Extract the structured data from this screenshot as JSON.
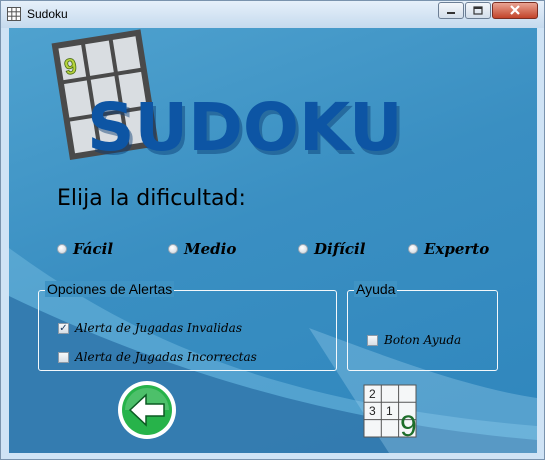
{
  "window": {
    "title": "Sudoku",
    "controls": {
      "minimize": "minimize-icon",
      "maximize": "maximize-icon",
      "close": "close-icon"
    }
  },
  "logo": {
    "text": "SUDOKU",
    "grid_digit": "9",
    "color": "#0d55a4"
  },
  "difficulty": {
    "heading": "Elija la dificultad:",
    "options": [
      "Fácil",
      "Medio",
      "Difícil",
      "Experto"
    ],
    "selected": null
  },
  "alerts": {
    "title": "Opciones de Alertas",
    "items": [
      {
        "label": "Alerta de Jugadas Invalidas",
        "checked": true,
        "mark": "✓"
      },
      {
        "label": "Alerta de Jugadas Incorrectas",
        "checked": false,
        "mark": ""
      }
    ]
  },
  "help": {
    "title": "Ayuda",
    "items": [
      {
        "label": "Boton Ayuda",
        "checked": false,
        "mark": ""
      }
    ]
  },
  "footer": {
    "back_icon": "left-arrow-icon",
    "mini_grid": {
      "digits": [
        "2",
        "3",
        "1"
      ],
      "big_digit": "9"
    }
  },
  "colors": {
    "background": "#3a8fc2",
    "logo": "#0d55a4",
    "back_button": "#27b34a",
    "big_digit": "#1d6e2a"
  }
}
